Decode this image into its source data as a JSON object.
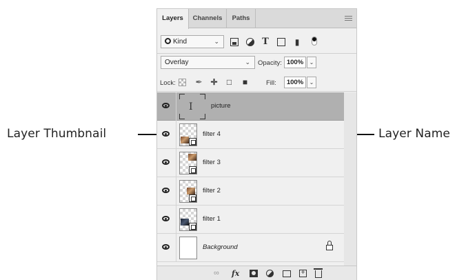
{
  "annotations": {
    "left_label": "Layer Thumbnail",
    "right_label": "Layer Name"
  },
  "panel": {
    "tabs": [
      {
        "label": "Layers",
        "active": true
      },
      {
        "label": "Channels",
        "active": false
      },
      {
        "label": "Paths",
        "active": false
      }
    ],
    "filter": {
      "kind_label": "Kind",
      "icons": [
        "image-filter-icon",
        "adjustment-filter-icon",
        "type-filter-icon",
        "shape-filter-icon",
        "smart-object-filter-icon",
        "filter-toggle-icon"
      ]
    },
    "blend_mode": "Overlay",
    "opacity_label": "Opacity:",
    "opacity_value": "100%",
    "lock_label": "Lock:",
    "fill_label": "Fill:",
    "fill_value": "100%",
    "layers": [
      {
        "name": "picture",
        "type": "text",
        "selected": true,
        "visible": true
      },
      {
        "name": "filter 4",
        "type": "smart",
        "selected": false,
        "visible": true
      },
      {
        "name": "filter 3",
        "type": "smart",
        "selected": false,
        "visible": true
      },
      {
        "name": "filter 2",
        "type": "smart",
        "selected": false,
        "visible": true
      },
      {
        "name": "filter 1",
        "type": "smart",
        "selected": false,
        "visible": true
      },
      {
        "name": "Background",
        "type": "background",
        "selected": false,
        "visible": true,
        "locked": true
      }
    ],
    "bottom_icons": [
      "link-icon",
      "fx-icon",
      "mask-icon",
      "adjustment-layer-icon",
      "group-folder-icon",
      "new-layer-icon",
      "trash-icon"
    ],
    "selected_row_color": "#b0b0b0"
  }
}
